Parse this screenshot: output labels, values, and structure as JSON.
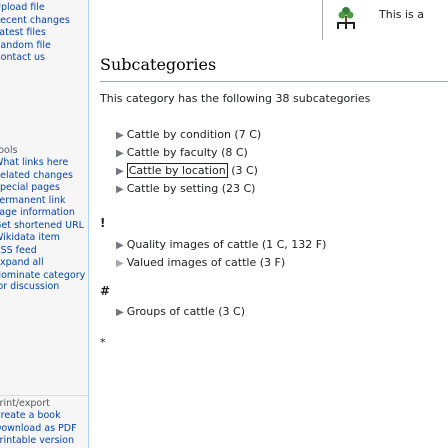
{
  "sidebar": {
    "group1": [
      {
        "label": "Upload file",
        "href": true
      },
      {
        "label": "Recent changes",
        "href": true
      },
      {
        "label": "Latest files",
        "href": true
      },
      {
        "label": "Random file",
        "href": true
      },
      {
        "label": "Contact us",
        "href": true
      }
    ],
    "tools_heading": "Tools",
    "group2": [
      "What links here",
      "Related changes",
      "Special pages",
      "Permanent link",
      "Page information",
      "Get shortened URL",
      "Wikidata item",
      "RSS feed",
      "Expand all",
      "Nominate category for discussion"
    ],
    "print_heading": "Print/export",
    "group3": [
      "Create a book",
      "Download as PDF",
      "Printable version"
    ]
  },
  "notice": {
    "text": "This is a",
    "icon": "category-tree-icon"
  },
  "section": {
    "heading": "Subcategories",
    "intro": "This category has the following 38 subcategories"
  },
  "subcategories": {
    "group_c": [
      {
        "name": "Cattle by condition",
        "count": "(7 C)"
      },
      {
        "name": "Cattle by faculty",
        "count": "(8 C)"
      },
      {
        "name": "Cattle by location",
        "count": "(3 C)"
      },
      {
        "name": "Cattle by setting",
        "count": "(23 C)"
      }
    ],
    "group_excl_letter": "!",
    "group_excl": [
      {
        "name": "Quality images of cattle",
        "count": "(1 C, 132 F)"
      },
      {
        "name": "Valued images of cattle",
        "count": "(3 F)"
      }
    ],
    "group_hash_letter": "#",
    "group_hash": [
      {
        "name": "Groups of cattle",
        "count": "(3 C)"
      }
    ],
    "group_star_letter": "*"
  },
  "colors": {
    "link": "#0645ad",
    "text": "#202122",
    "sidebar_bg": "#f6f6f6",
    "border": "#a7d7f9"
  }
}
